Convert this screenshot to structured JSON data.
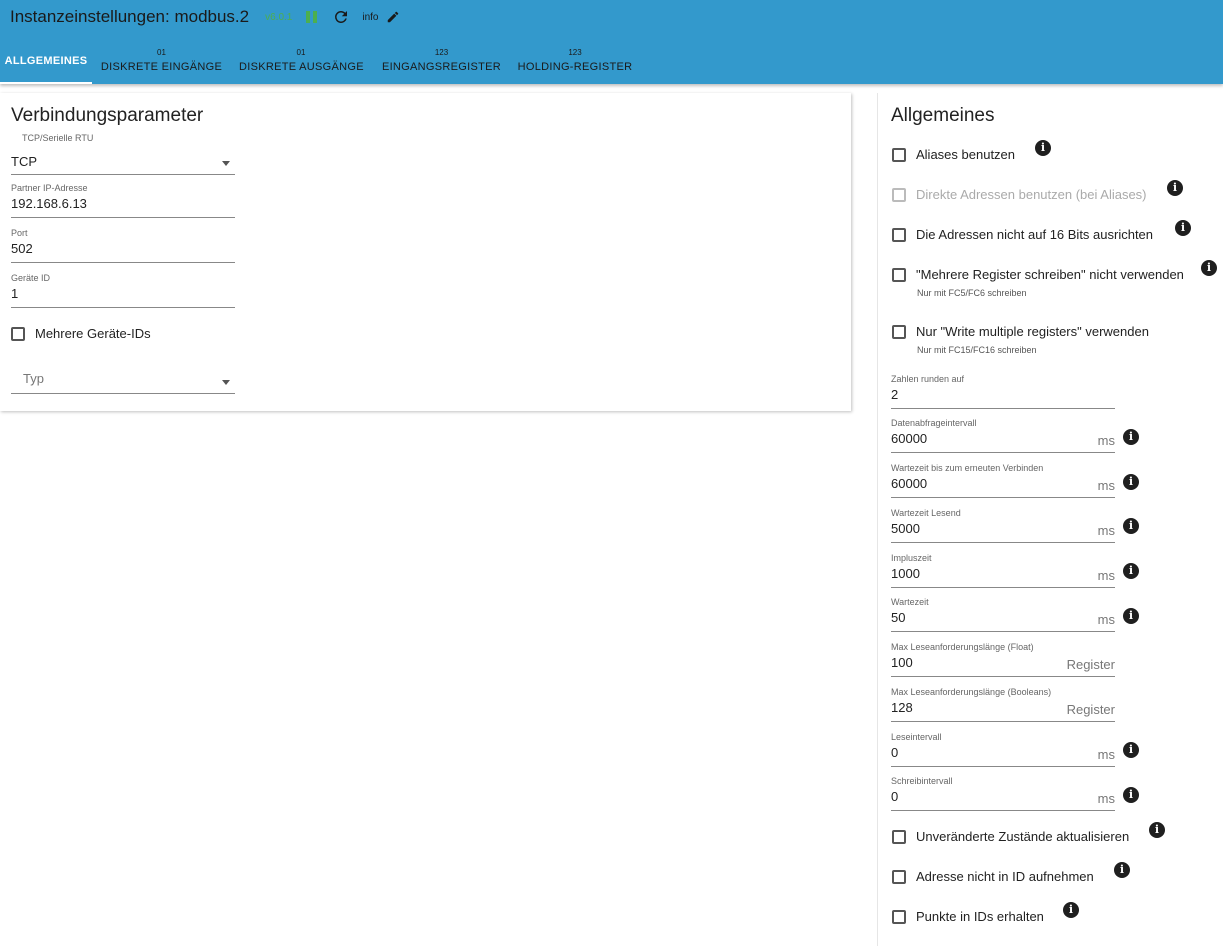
{
  "header": {
    "title": "Instanzeinstellungen: modbus.2",
    "version": "v6.0.1",
    "info_label": "info",
    "bg_color": "#3399cc",
    "status_color": "#4caf50"
  },
  "tabs": [
    {
      "sup": "",
      "label": "ALLGEMEINES",
      "active": true
    },
    {
      "sup": "01",
      "label": "DISKRETE EINGÄNGE"
    },
    {
      "sup": "01",
      "label": "DISKRETE AUSGÄNGE"
    },
    {
      "sup": "123",
      "label": "EINGANGSREGISTER"
    },
    {
      "sup": "123",
      "label": "HOLDING-REGISTER"
    }
  ],
  "connection": {
    "title": "Verbindungsparameter",
    "type": {
      "label": "TCP/Serielle RTU",
      "value": "TCP"
    },
    "ip": {
      "label": "Partner IP-Adresse",
      "value": "192.168.6.13"
    },
    "port": {
      "label": "Port",
      "value": "502"
    },
    "device_id": {
      "label": "Geräte ID",
      "value": "1"
    },
    "multi_ids": {
      "label": "Mehrere Geräte-IDs",
      "checked": false
    },
    "typ": {
      "placeholder": "Typ"
    }
  },
  "general": {
    "title": "Allgemeines",
    "checkboxes": [
      {
        "label": "Aliases benutzen",
        "checked": false,
        "disabled": false,
        "note": ""
      },
      {
        "label": "Direkte Adressen benutzen (bei Aliases)",
        "checked": false,
        "disabled": true,
        "note": ""
      },
      {
        "label": "Die Adressen nicht auf 16 Bits ausrichten",
        "checked": false,
        "disabled": false,
        "note": ""
      },
      {
        "label": "\"Mehrere Register schreiben\" nicht verwenden",
        "checked": false,
        "disabled": false,
        "note": "Nur mit FC5/FC6 schreiben"
      },
      {
        "label": "Nur \"Write multiple registers\" verwenden",
        "checked": false,
        "disabled": false,
        "note": "Nur mit FC15/FC16 schreiben"
      }
    ],
    "fields": [
      {
        "label": "Zahlen runden auf",
        "value": "2",
        "unit": ""
      },
      {
        "label": "Datenabfrageintervall",
        "value": "60000",
        "unit": "ms"
      },
      {
        "label": "Wartezeit bis zum erneuten Verbinden",
        "value": "60000",
        "unit": "ms"
      },
      {
        "label": "Wartezeit Lesend",
        "value": "5000",
        "unit": "ms"
      },
      {
        "label": "Impluszeit",
        "value": "1000",
        "unit": "ms"
      },
      {
        "label": "Wartezeit",
        "value": "50",
        "unit": "ms"
      },
      {
        "label": "Max Leseanforderungslänge (Float)",
        "value": "100",
        "unit": "Register"
      },
      {
        "label": "Max Leseanforderungslänge (Booleans)",
        "value": "128",
        "unit": "Register"
      },
      {
        "label": "Leseintervall",
        "value": "0",
        "unit": "ms"
      },
      {
        "label": "Schreibintervall",
        "value": "0",
        "unit": "ms"
      }
    ],
    "bottom_checkboxes": [
      {
        "label": "Unveränderte Zustände aktualisieren",
        "checked": false
      },
      {
        "label": "Adresse nicht in ID aufnehmen",
        "checked": false
      },
      {
        "label": "Punkte in IDs erhalten",
        "checked": false
      }
    ]
  }
}
